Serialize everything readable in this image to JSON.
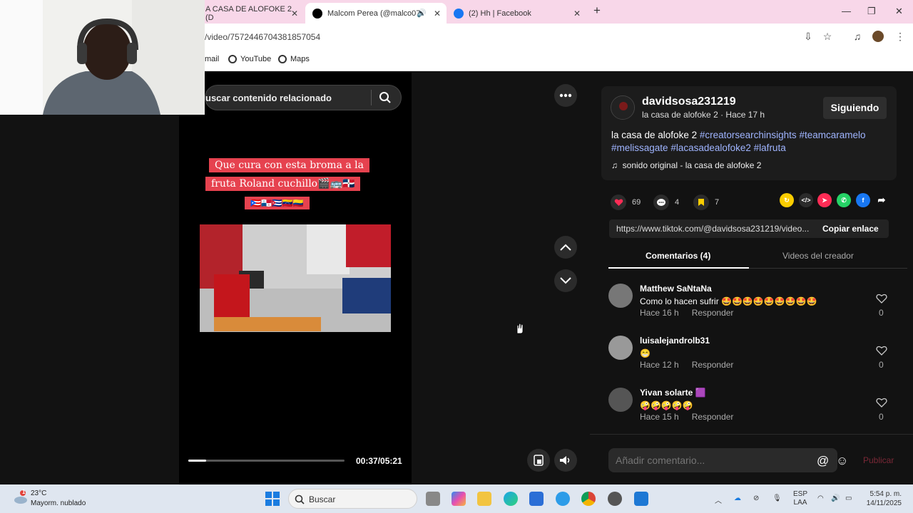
{
  "browser": {
    "tabs": [
      {
        "title": "A CASA DE ALOFOKE 2 (D",
        "icon": "tab-favicon"
      },
      {
        "title": "Malcom Perea (@malco07",
        "icon": "tiktok-icon"
      },
      {
        "title": "(2) Hh | Facebook",
        "icon": "facebook-icon"
      }
    ],
    "url": "/video/7572446704381857054",
    "bookmarks": [
      "mail",
      "YouTube",
      "Maps"
    ]
  },
  "video": {
    "search_placeholder": "uscar contenido relacionado",
    "caption_lines": [
      "Que cura con esta broma a la",
      "fruta Roland cuchillo🎬🚌🇩🇴",
      "🇵🇷🇵🇦🇨🇺🇻🇪🇨🇴"
    ],
    "time": "00:37/05:21",
    "progress": 0.115
  },
  "post": {
    "username": "davidsosa231219",
    "subline": "la casa de alofoke 2 · Hace 17 h",
    "follow_label": "Siguiendo",
    "desc_text": "la casa de alofoke 2 ",
    "tags": [
      "#creatorsearchinsights",
      "#teamcaramelo",
      "#melissagate",
      "#lacasadealofoke2",
      "#lafruta"
    ],
    "sound": "sonido original - la casa de alofoke 2",
    "likes": "69",
    "comments_count": "4",
    "saves": "7",
    "link": "https://www.tiktok.com/@davidsosa231219/video...",
    "copy_label": "Copiar enlace",
    "tab_comments": "Comentarios (4)",
    "tab_videos": "Videos del creador"
  },
  "comments": [
    {
      "name": "Matthew SaNtaNa",
      "text": "Como lo hacen sufrir 🤩🤩🤩🤩🤩🤩🤩🤩🤩",
      "time": "Hace 16 h",
      "reply": "Responder",
      "likes": "0"
    },
    {
      "name": "luisalejandrolb31",
      "text": "😁",
      "time": "Hace 12 h",
      "reply": "Responder",
      "likes": "0"
    },
    {
      "name": "Yivan solarte 🟪",
      "text": "🤪🤪🤪🤪🤪",
      "time": "Hace 15 h",
      "reply": "Responder",
      "likes": "0"
    }
  ],
  "composer": {
    "placeholder": "Añadir comentario...",
    "post_label": "Publicar"
  },
  "taskbar": {
    "weather_temp": "23°C",
    "weather_desc": "Mayorm. nublado",
    "search_label": "Buscar",
    "lang": "ESP",
    "lang2": "LAA",
    "clock_time": "5:54 p. m.",
    "clock_date": "14/11/2025",
    "notification_badge": "1"
  }
}
